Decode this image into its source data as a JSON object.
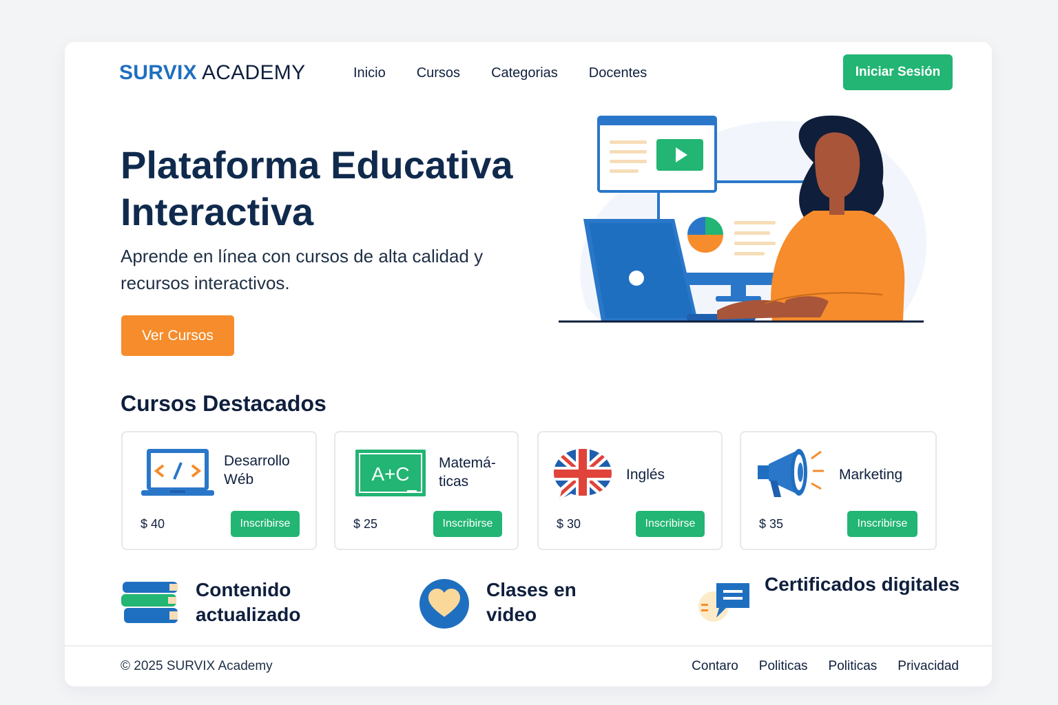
{
  "header": {
    "logo_brand": "SURVIX",
    "logo_rest": "ACADEMY",
    "nav": [
      "Inicio",
      "Cursos",
      "Categorias",
      "Docentes"
    ],
    "login_label": "Iniciar Sesión"
  },
  "hero": {
    "title": "Plataforma Educativa Interactiva",
    "subtitle": "Aprende en línea con cursos de alta calidad y recursos interactivos.",
    "cta_label": "Ver Cursos"
  },
  "courses": {
    "title": "Cursos Destacados",
    "items": [
      {
        "name": "Desarrollo Wéb",
        "price": "$ 40",
        "button": "Inscribirse",
        "icon": "laptop-code-icon"
      },
      {
        "name": "Matemá- ticas",
        "price": "$ 25",
        "button": "Inscribirse",
        "icon": "chalkboard-icon",
        "icon_text": "A+C"
      },
      {
        "name": "Inglés",
        "price": "$ 30",
        "button": "Inscribirse",
        "icon": "uk-flag-bubble-icon"
      },
      {
        "name": "Marketing",
        "price": "$ 35",
        "button": "Inscribirse",
        "icon": "megaphone-icon"
      }
    ]
  },
  "features": [
    {
      "label": "Contenido actualizado",
      "icon": "books-icon"
    },
    {
      "label": "Clases en video",
      "icon": "heart-circle-icon"
    },
    {
      "label": "Certificados digitales",
      "icon": "chat-certificate-icon"
    }
  ],
  "footer": {
    "copyright": "© 2025 SURVIX Academy",
    "links": [
      "Contaro",
      "Politicas",
      "Politicas",
      "Privacidad"
    ]
  },
  "colors": {
    "brand_blue": "#1f6fc0",
    "primary_green": "#22b573",
    "accent_orange": "#f68c2b",
    "text_dark": "#0f1f3d"
  }
}
